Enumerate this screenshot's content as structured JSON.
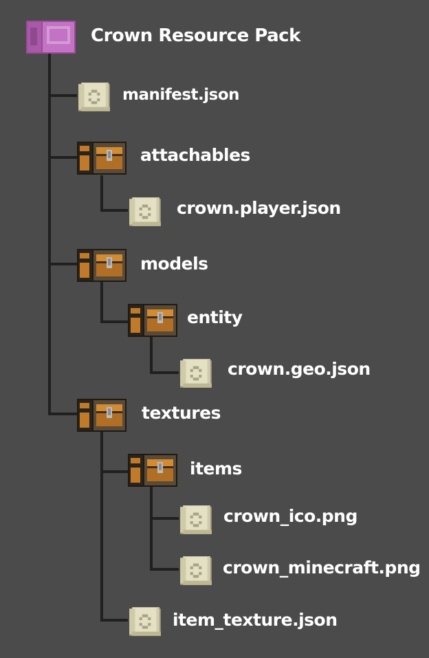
{
  "tree": {
    "root": {
      "label": "Crown Resource Pack",
      "icon": "resource-pack-icon",
      "color": "#b05ab0"
    },
    "nodes": [
      {
        "label": "manifest.json",
        "icon": "file-scroll-icon"
      },
      {
        "label": "attachables",
        "icon": "folder-chest-icon"
      },
      {
        "label": "crown.player.json",
        "icon": "file-scroll-icon"
      },
      {
        "label": "models",
        "icon": "folder-chest-icon"
      },
      {
        "label": "entity",
        "icon": "folder-chest-icon"
      },
      {
        "label": "crown.geo.json",
        "icon": "file-scroll-icon"
      },
      {
        "label": "textures",
        "icon": "folder-chest-icon"
      },
      {
        "label": "items",
        "icon": "folder-chest-icon"
      },
      {
        "label": "crown_ico.png",
        "icon": "file-scroll-icon"
      },
      {
        "label": "crown_minecraft.png",
        "icon": "file-scroll-icon"
      },
      {
        "label": "item_texture.json",
        "icon": "file-scroll-icon"
      }
    ]
  },
  "colors": {
    "background": "#4b4b4b",
    "connector": "#202020",
    "text": "#ffffff",
    "folder": "#c07a2a",
    "file": "#d8d4b4"
  }
}
